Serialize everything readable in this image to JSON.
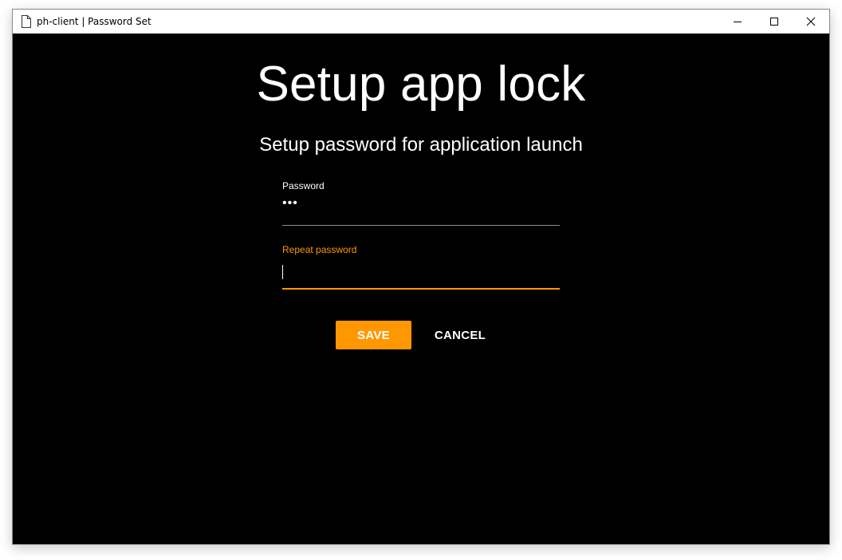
{
  "window": {
    "title": "ph-client | Password Set",
    "icons": {
      "app": "document-icon",
      "minimize": "minimize-icon",
      "maximize": "maximize-icon",
      "close": "close-icon"
    }
  },
  "main": {
    "title": "Setup app lock",
    "subtitle": "Setup password for application launch"
  },
  "form": {
    "password": {
      "label": "Password",
      "value": "•••"
    },
    "repeat_password": {
      "label": "Repeat password",
      "value": "",
      "focused": true
    }
  },
  "actions": {
    "save_label": "SAVE",
    "cancel_label": "CANCEL"
  },
  "colors": {
    "accent": "#ff9800",
    "background": "#000000",
    "text": "#ffffff",
    "underline_idle": "#8c8c8c"
  }
}
